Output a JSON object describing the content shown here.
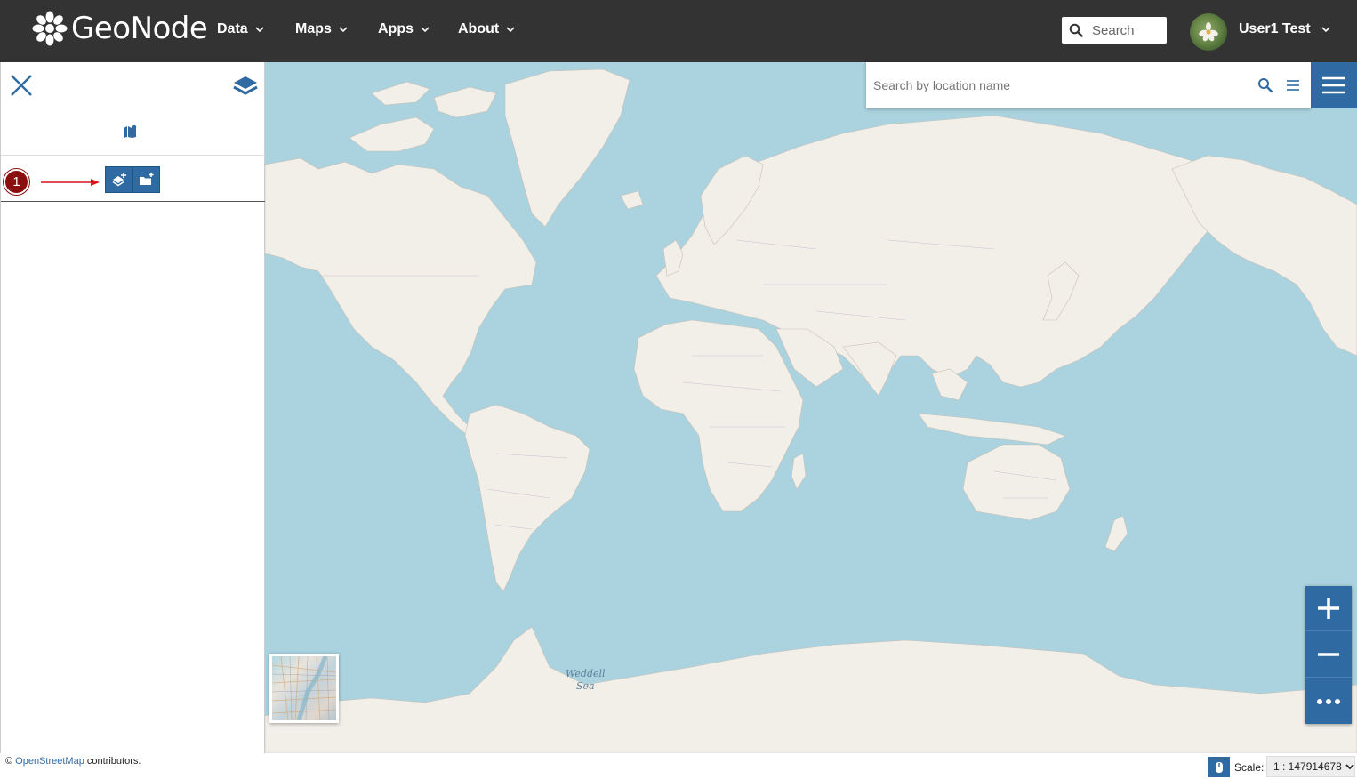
{
  "header": {
    "logo_text": "GeoNode",
    "nav": [
      {
        "label": "Data"
      },
      {
        "label": "Maps"
      },
      {
        "label": "Apps"
      },
      {
        "label": "About"
      }
    ],
    "search_placeholder": "Search",
    "user_name": "User1 Test"
  },
  "panel": {
    "step_badge": "1",
    "icons": [
      "close-icon",
      "layers-icon",
      "map-catalog-icon",
      "add-layer-icon",
      "add-group-icon"
    ]
  },
  "map": {
    "location_search_placeholder": "Search by location name",
    "sea_label_line1": "Weddell",
    "sea_label_line2": "Sea",
    "colors": {
      "water": "#aad3df",
      "land": "#f2efe9",
      "accent": "#2f6aa3",
      "topbar": "#333333",
      "badge": "#8b0e0e"
    }
  },
  "footer": {
    "attribution_prefix": "©",
    "attribution_link": "OpenStreetMap",
    "attribution_suffix": "contributors.",
    "scale_label": "Scale:",
    "scale_value": "1 : 147914678"
  }
}
